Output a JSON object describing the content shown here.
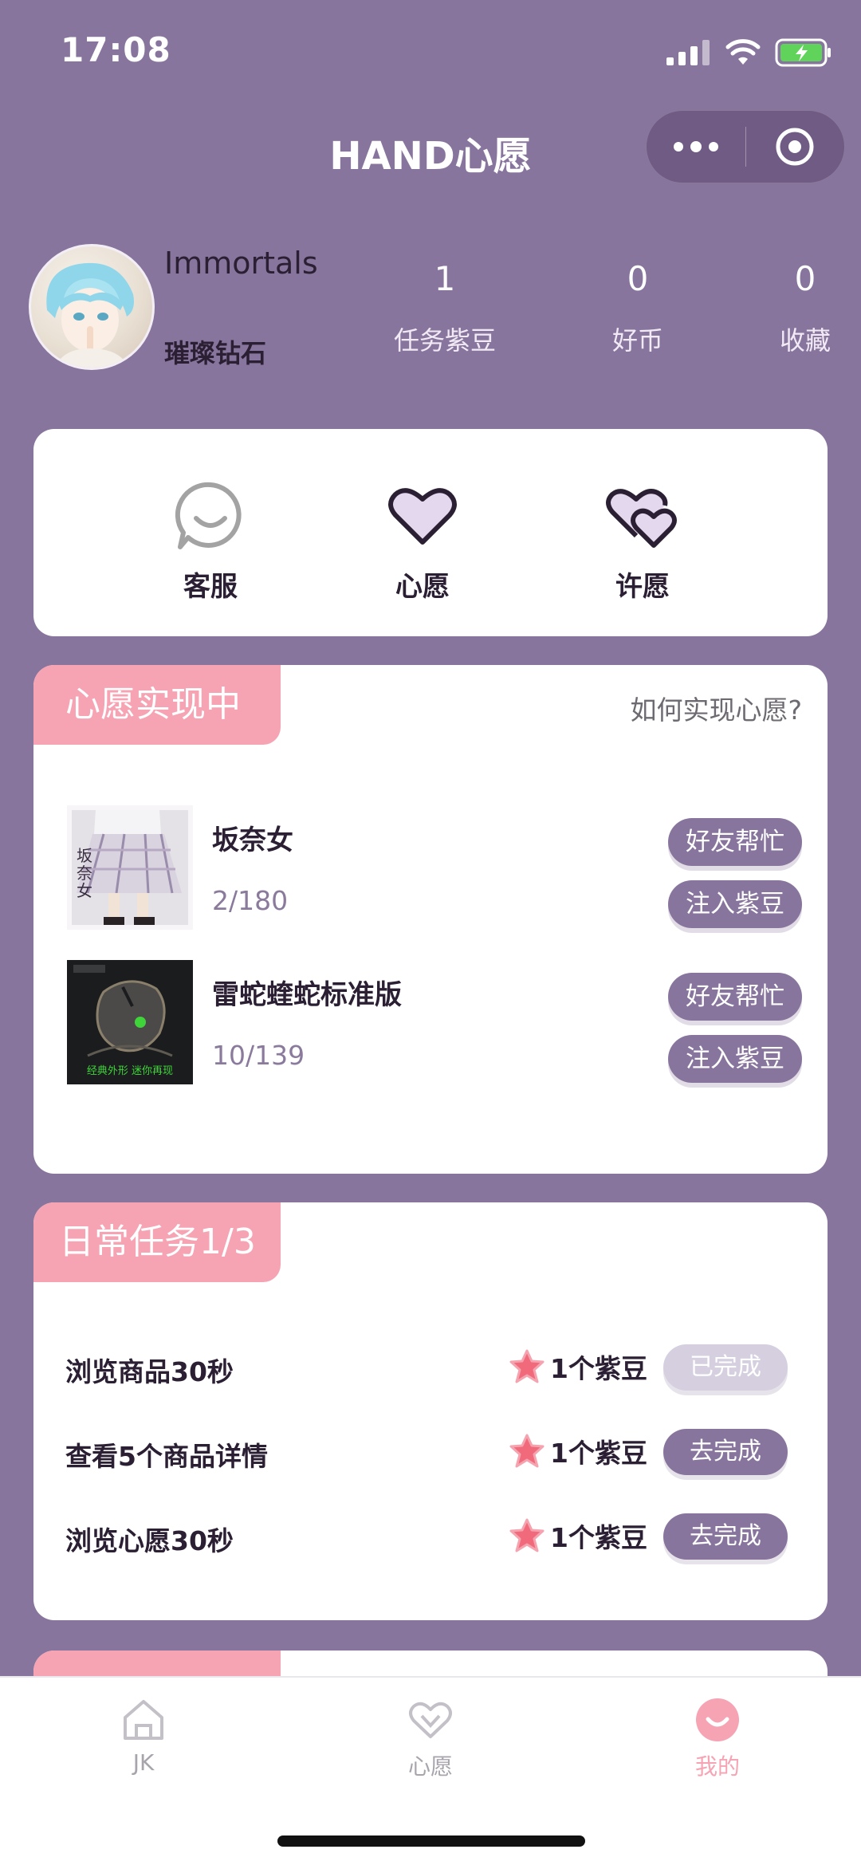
{
  "status_bar": {
    "time": "17:08"
  },
  "nav": {
    "title": "HAND心愿"
  },
  "profile": {
    "username": "Immortals",
    "rank": "璀璨钻石",
    "stats": [
      {
        "value": "1",
        "label": "任务紫豆"
      },
      {
        "value": "0",
        "label": "好币"
      },
      {
        "value": "0",
        "label": "收藏"
      }
    ]
  },
  "quick_actions": [
    {
      "label": "客服",
      "icon": "chat-smile-icon"
    },
    {
      "label": "心愿",
      "icon": "heart-icon"
    },
    {
      "label": "许愿",
      "icon": "double-heart-icon"
    }
  ],
  "wish_section": {
    "title": "心愿实现中",
    "help_link": "如何实现心愿?",
    "items": [
      {
        "name": "坂奈女",
        "progress": "2/180",
        "thumb_text": "坂奈女",
        "help_label": "好友帮忙",
        "inject_label": "注入紫豆"
      },
      {
        "name": "雷蛇蝰蛇标准版",
        "progress": "10/139",
        "thumb_text": "经典外形 迷你再现",
        "help_label": "好友帮忙",
        "inject_label": "注入紫豆"
      }
    ]
  },
  "task_section": {
    "title": "日常任务1/3",
    "tasks": [
      {
        "name": "浏览商品30秒",
        "reward": "1个紫豆",
        "status": "已完成",
        "done": true
      },
      {
        "name": "查看5个商品详情",
        "reward": "1个紫豆",
        "status": "去完成",
        "done": false
      },
      {
        "name": "浏览心愿30秒",
        "reward": "1个紫豆",
        "status": "去完成",
        "done": false
      }
    ]
  },
  "tabbar": {
    "tabs": [
      {
        "label": "JK",
        "icon": "home-icon",
        "active": false
      },
      {
        "label": "心愿",
        "icon": "heart-outline-icon",
        "active": false
      },
      {
        "label": "我的",
        "icon": "smile-icon",
        "active": true
      }
    ]
  },
  "colors": {
    "primary": "#88759d",
    "accent_pink": "#f6a3b3",
    "done_gray": "#d5cfdf"
  }
}
